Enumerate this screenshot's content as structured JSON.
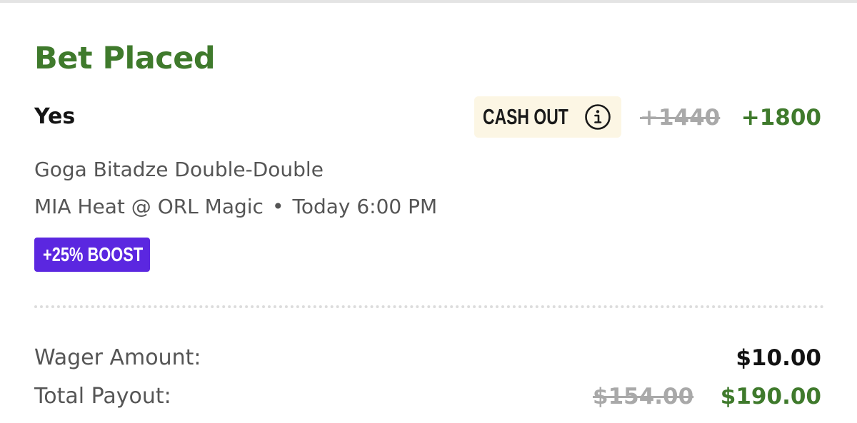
{
  "bet": {
    "status_title": "Bet Placed",
    "selection": "Yes",
    "cash_out_label": "CASH OUT",
    "odds_original": "+1440",
    "odds_boosted": "+1800",
    "market": "Goga Bitadze Double-Double",
    "matchup": "MIA Heat @ ORL Magic",
    "separator": "•",
    "start_time": "Today 6:00 PM",
    "boost_badge": "+25% BOOST"
  },
  "summary": {
    "wager_label": "Wager Amount:",
    "wager_value": "$10.00",
    "payout_label": "Total Payout:",
    "payout_original": "$154.00",
    "payout_boosted": "$190.00"
  },
  "icons": {
    "cash_out_info": "info-circle-icon"
  },
  "colors": {
    "accent_green": "#3f7a2c",
    "boost_purple": "#5b27e0",
    "cash_out_bg": "#fcf6e4",
    "struck_gray": "#a9a9a9"
  }
}
